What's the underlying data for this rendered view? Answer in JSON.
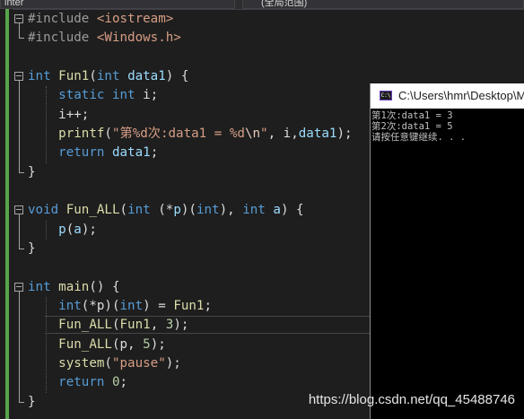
{
  "toolbar": {
    "scope_left": "inter",
    "scope_right": "(全局范围)"
  },
  "code_lines": [
    [
      {
        "t": "#include ",
        "c": "pp"
      },
      {
        "t": "<iostream>",
        "c": "inc"
      }
    ],
    [
      {
        "t": "#include ",
        "c": "pp"
      },
      {
        "t": "<Windows.h>",
        "c": "inc"
      }
    ],
    [],
    [
      {
        "t": "int ",
        "c": "kw"
      },
      {
        "t": "Fun1",
        "c": "fn"
      },
      {
        "t": "(",
        "c": ""
      },
      {
        "t": "int ",
        "c": "kw"
      },
      {
        "t": "data1",
        "c": "prm"
      },
      {
        "t": ") {",
        "c": ""
      }
    ],
    [
      {
        "t": "    static ",
        "c": "kw"
      },
      {
        "t": "int ",
        "c": "kw"
      },
      {
        "t": "i;",
        "c": ""
      }
    ],
    [
      {
        "t": "    i++;",
        "c": ""
      }
    ],
    [
      {
        "t": "    ",
        "c": ""
      },
      {
        "t": "printf",
        "c": "fn"
      },
      {
        "t": "(",
        "c": ""
      },
      {
        "t": "\"第%d次:data1 = %d",
        "c": "str"
      },
      {
        "t": "\\n",
        "c": "esc"
      },
      {
        "t": "\"",
        "c": "str"
      },
      {
        "t": ", i,",
        "c": ""
      },
      {
        "t": "data1",
        "c": "prm"
      },
      {
        "t": ");",
        "c": ""
      }
    ],
    [
      {
        "t": "    ",
        "c": ""
      },
      {
        "t": "return ",
        "c": "kw"
      },
      {
        "t": "data1",
        "c": "prm"
      },
      {
        "t": ";",
        "c": ""
      }
    ],
    [
      {
        "t": "}",
        "c": ""
      }
    ],
    [],
    [
      {
        "t": "void ",
        "c": "kw"
      },
      {
        "t": "Fun_ALL",
        "c": "fn"
      },
      {
        "t": "(",
        "c": ""
      },
      {
        "t": "int ",
        "c": "kw"
      },
      {
        "t": "(*",
        "c": ""
      },
      {
        "t": "p",
        "c": "prm"
      },
      {
        "t": ")(",
        "c": ""
      },
      {
        "t": "int",
        "c": "kw"
      },
      {
        "t": "), ",
        "c": ""
      },
      {
        "t": "int ",
        "c": "kw"
      },
      {
        "t": "a",
        "c": "prm"
      },
      {
        "t": ") {",
        "c": ""
      }
    ],
    [
      {
        "t": "    ",
        "c": ""
      },
      {
        "t": "p",
        "c": "prm"
      },
      {
        "t": "(",
        "c": ""
      },
      {
        "t": "a",
        "c": "prm"
      },
      {
        "t": ");",
        "c": ""
      }
    ],
    [
      {
        "t": "}",
        "c": ""
      }
    ],
    [],
    [
      {
        "t": "int ",
        "c": "kw"
      },
      {
        "t": "main",
        "c": "fn"
      },
      {
        "t": "() {",
        "c": ""
      }
    ],
    [
      {
        "t": "    ",
        "c": ""
      },
      {
        "t": "int",
        "c": "kw"
      },
      {
        "t": "(*p)(",
        "c": ""
      },
      {
        "t": "int",
        "c": "kw"
      },
      {
        "t": ") = ",
        "c": ""
      },
      {
        "t": "Fun1",
        "c": "fn"
      },
      {
        "t": ";",
        "c": ""
      }
    ],
    [
      {
        "t": "    ",
        "c": ""
      },
      {
        "t": "Fun_ALL",
        "c": "fn"
      },
      {
        "t": "(",
        "c": ""
      },
      {
        "t": "Fun1",
        "c": "fn"
      },
      {
        "t": ", ",
        "c": ""
      },
      {
        "t": "3",
        "c": "num"
      },
      {
        "t": ");",
        "c": ""
      }
    ],
    [
      {
        "t": "    ",
        "c": ""
      },
      {
        "t": "Fun_ALL",
        "c": "fn"
      },
      {
        "t": "(p, ",
        "c": ""
      },
      {
        "t": "5",
        "c": "num"
      },
      {
        "t": ");",
        "c": ""
      }
    ],
    [
      {
        "t": "    ",
        "c": ""
      },
      {
        "t": "system",
        "c": "fn"
      },
      {
        "t": "(",
        "c": ""
      },
      {
        "t": "\"pause\"",
        "c": "str"
      },
      {
        "t": ");",
        "c": ""
      }
    ],
    [
      {
        "t": "    ",
        "c": ""
      },
      {
        "t": "return ",
        "c": "kw"
      },
      {
        "t": "0",
        "c": "num"
      },
      {
        "t": ";",
        "c": ""
      }
    ],
    [
      {
        "t": "}",
        "c": ""
      }
    ]
  ],
  "console": {
    "title": "C:\\Users\\hmr\\Desktop\\M",
    "icon_label": "C:\\",
    "lines": [
      "第1次:data1 = 3",
      "第2次:data1 = 5",
      "请按任意键继续. . ."
    ]
  },
  "watermark": "https://blog.csdn.net/qq_45488746"
}
